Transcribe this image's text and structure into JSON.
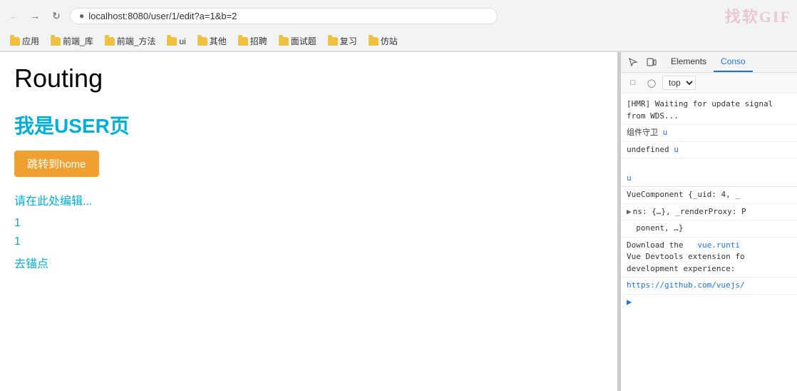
{
  "browser": {
    "url": "localhost:8080/user/1/edit?a=1&b=2",
    "watermark": "找软GIF"
  },
  "bookmarks": [
    {
      "label": "应用",
      "folder": true
    },
    {
      "label": "前端_库",
      "folder": true
    },
    {
      "label": "前端_方法",
      "folder": true
    },
    {
      "label": "ui",
      "folder": true
    },
    {
      "label": "其他",
      "folder": true
    },
    {
      "label": "招聘",
      "folder": true
    },
    {
      "label": "面试题",
      "folder": true
    },
    {
      "label": "复习",
      "folder": true
    },
    {
      "label": "仿站",
      "folder": true
    }
  ],
  "page": {
    "title": "Routing",
    "user_heading": "我是USER页",
    "jump_button": "跳转到home",
    "edit_placeholder": "请在此处编辑...",
    "param_a": "1",
    "param_b": "1",
    "anchor_text": "去锚点"
  },
  "devtools": {
    "tabs": [
      "Elements",
      "Conso"
    ],
    "active_tab": "Conso",
    "top_label": "top",
    "console_lines": [
      {
        "text": "[HMR] Waiting for update signal from WDS...",
        "type": "normal"
      },
      {
        "text": "组件守卫",
        "type": "normal",
        "has_link": true
      },
      {
        "text": "undefined",
        "type": "normal",
        "has_link": true
      },
      {
        "text": "",
        "type": "spacer"
      },
      {
        "text": "VueComponent {_uid: 4, _",
        "type": "object"
      },
      {
        "text": "▶ ns: {…}, _renderProxy: P",
        "type": "object"
      },
      {
        "text": "ponent, …}",
        "type": "object"
      },
      {
        "text": "Download the  vue.runti Vue Devtools extension fo development experience:",
        "type": "normal"
      },
      {
        "text": "https://github.com/vuejs/",
        "type": "link"
      }
    ]
  }
}
